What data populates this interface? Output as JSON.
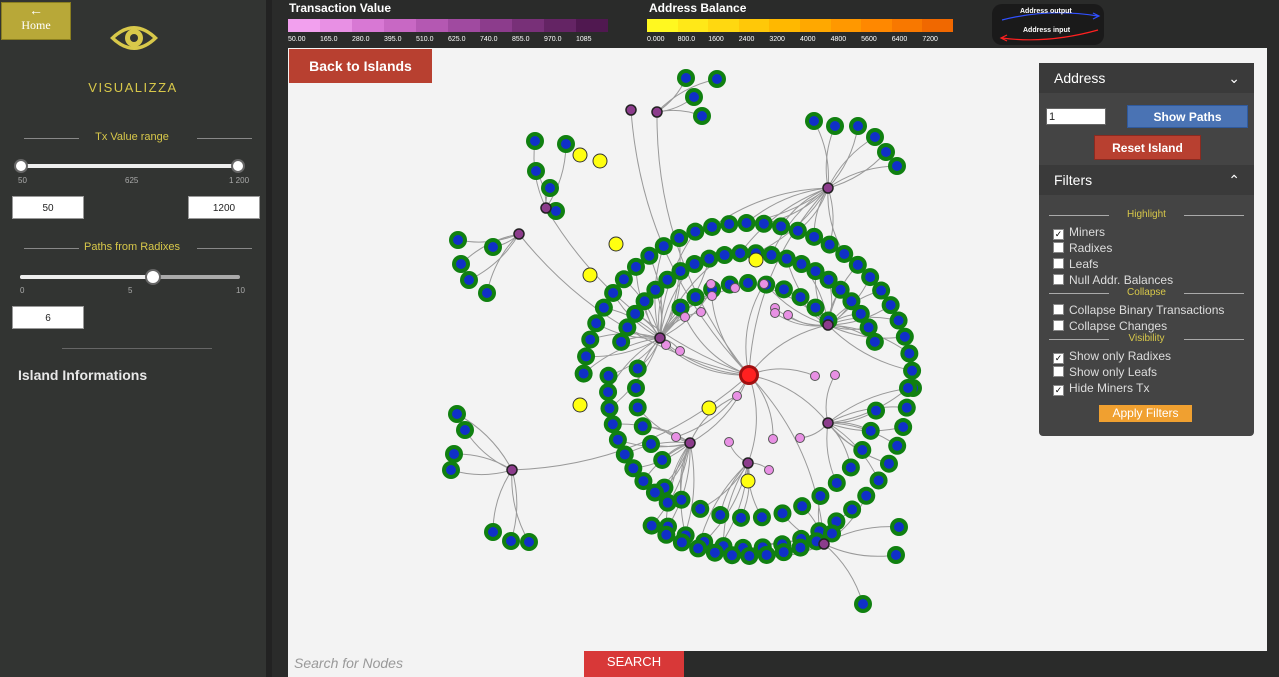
{
  "sidebar": {
    "home_label": "Home",
    "app_name": "VISUALIZZA",
    "tx_range": {
      "title": "Tx Value range",
      "ticks": [
        "50",
        "625",
        "1 200"
      ],
      "min_value": "50",
      "max_value": "1200"
    },
    "paths": {
      "title": "Paths from Radixes",
      "ticks": [
        "0",
        "5",
        "10"
      ],
      "value": "6"
    },
    "island_info_title": "Island Informations"
  },
  "legend": {
    "tx_value_title": "Transaction Value",
    "tx_value_ticks": [
      "50.00",
      "165.0",
      "280.0",
      "395.0",
      "510.0",
      "625.0",
      "740.0",
      "855.0",
      "970.0",
      "1085"
    ],
    "tx_value_colors": [
      "#f2a0ee",
      "#e890e4",
      "#d878d4",
      "#c868c4",
      "#b458b2",
      "#a04aa0",
      "#8c3c8c",
      "#783078",
      "#642464",
      "#501850"
    ],
    "balance_title": "Address Balance",
    "balance_ticks": [
      "0.000",
      "800.0",
      "1600",
      "2400",
      "3200",
      "4000",
      "4800",
      "5600",
      "6400",
      "7200"
    ],
    "balance_colors": [
      "#fff820",
      "#ffe818",
      "#ffd810",
      "#ffc808",
      "#ffb800",
      "#ffa800",
      "#ff9800",
      "#ff8800",
      "#f87800",
      "#f06800"
    ],
    "address_output": "Address output",
    "address_input": "Address input"
  },
  "canvas": {
    "back_button": "Back to Islands"
  },
  "panel": {
    "address_title": "Address",
    "address_value": "1",
    "show_paths": "Show Paths",
    "reset_island": "Reset Island",
    "filters_title": "Filters",
    "highlight_title": "Highlight",
    "highlight": [
      {
        "label": "Miners",
        "checked": true
      },
      {
        "label": "Radixes",
        "checked": false
      },
      {
        "label": "Leafs",
        "checked": false
      },
      {
        "label": "Null Addr. Balances",
        "checked": false
      }
    ],
    "collapse_title": "Collapse",
    "collapse": [
      {
        "label": "Collapse Binary Transactions",
        "checked": false
      },
      {
        "label": "Collapse Changes",
        "checked": false
      }
    ],
    "visibility_title": "Visibility",
    "visibility": [
      {
        "label": "Show only Radixes",
        "checked": true
      },
      {
        "label": "Show only Leafs",
        "checked": false
      },
      {
        "label": "Hide Miners Tx",
        "checked": true
      }
    ],
    "apply_filters": "Apply Filters"
  },
  "search": {
    "placeholder": "Search for Nodes",
    "button": "SEARCH"
  },
  "colors": {
    "leaf_fill": "#1030c8",
    "leaf_ring": "#108010",
    "tx_node": "#e890e4",
    "tx_node_dark": "#8c3c8c",
    "yellow_node": "#ffff10",
    "center_node": "#ff2020"
  }
}
